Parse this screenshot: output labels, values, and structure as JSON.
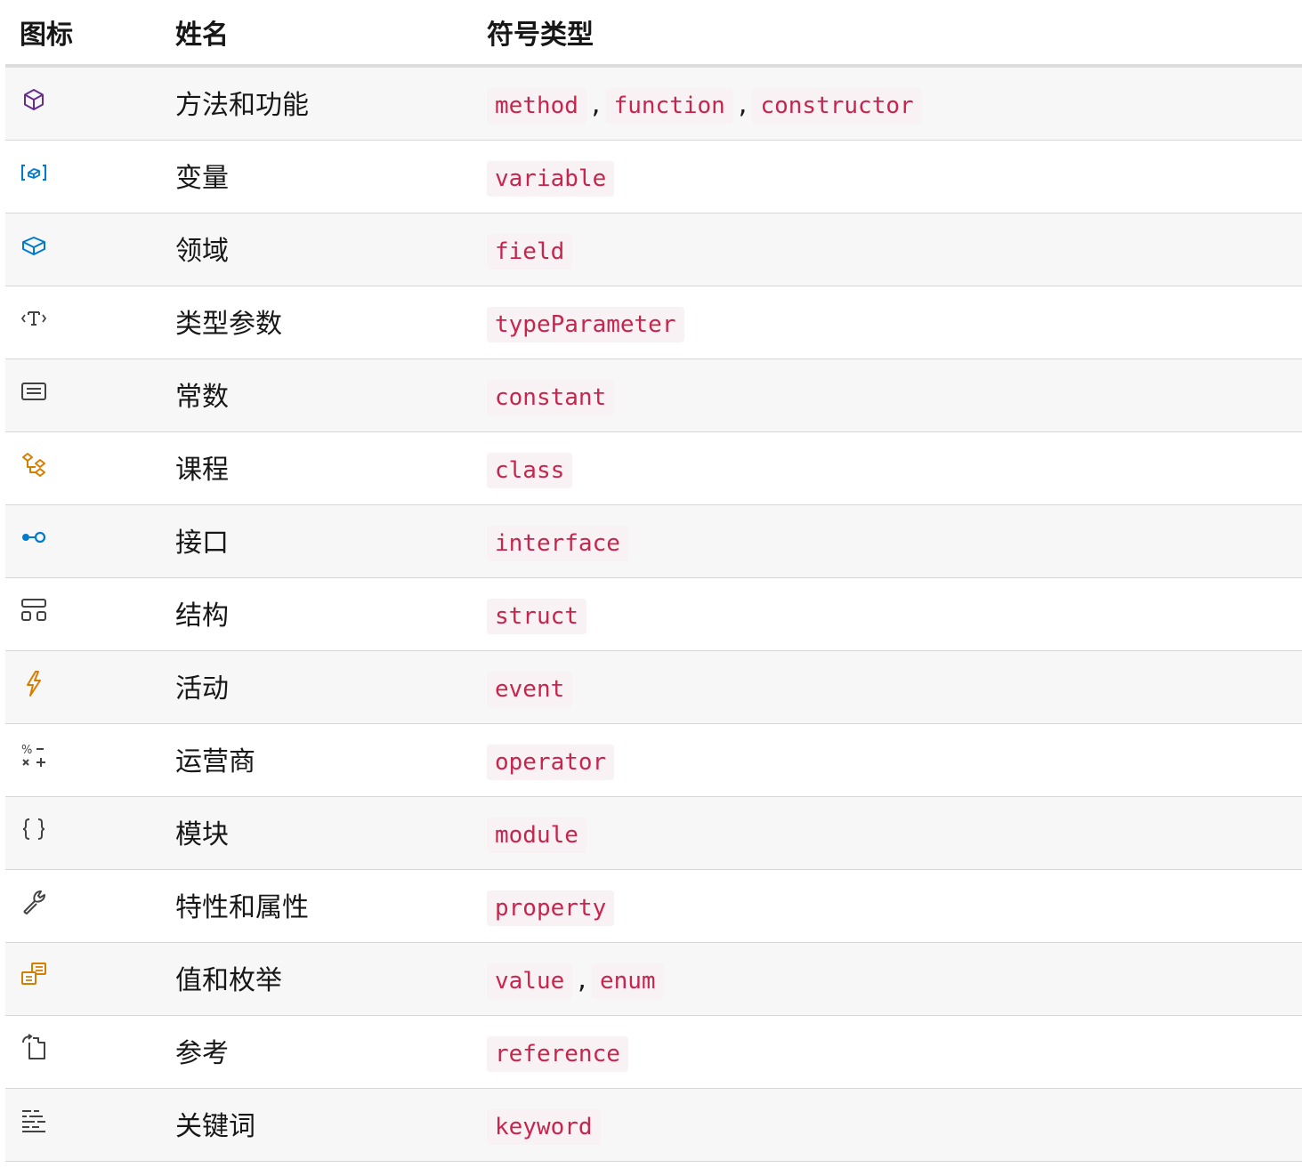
{
  "headers": {
    "icon": "图标",
    "name": "姓名",
    "kind": "符号类型"
  },
  "rows": [
    {
      "icon": "method-cube-icon",
      "color": "#652d90",
      "name": "方法和功能",
      "kinds": [
        "method",
        "function",
        "constructor"
      ]
    },
    {
      "icon": "variable-icon",
      "color": "#007acc",
      "name": "变量",
      "kinds": [
        "variable"
      ]
    },
    {
      "icon": "field-cube-icon",
      "color": "#007acc",
      "name": "领域",
      "kinds": [
        "field"
      ]
    },
    {
      "icon": "type-parameter-icon",
      "color": "#424242",
      "name": "类型参数",
      "kinds": [
        "typeParameter"
      ]
    },
    {
      "icon": "constant-icon",
      "color": "#424242",
      "name": "常数",
      "kinds": [
        "constant"
      ]
    },
    {
      "icon": "class-icon",
      "color": "#d67e00",
      "name": "课程",
      "kinds": [
        "class"
      ]
    },
    {
      "icon": "interface-icon",
      "color": "#007acc",
      "name": "接口",
      "kinds": [
        "interface"
      ]
    },
    {
      "icon": "struct-icon",
      "color": "#424242",
      "name": "结构",
      "kinds": [
        "struct"
      ]
    },
    {
      "icon": "event-lightning-icon",
      "color": "#d67e00",
      "name": "活动",
      "kinds": [
        "event"
      ]
    },
    {
      "icon": "operator-icon",
      "color": "#424242",
      "name": "运营商",
      "kinds": [
        "operator"
      ]
    },
    {
      "icon": "module-braces-icon",
      "color": "#424242",
      "name": "模块",
      "kinds": [
        "module"
      ]
    },
    {
      "icon": "property-wrench-icon",
      "color": "#424242",
      "name": "特性和属性",
      "kinds": [
        "property"
      ]
    },
    {
      "icon": "enum-icon",
      "color": "#d67e00",
      "name": "值和枚举",
      "kinds": [
        "value",
        "enum"
      ]
    },
    {
      "icon": "reference-icon",
      "color": "#424242",
      "name": "参考",
      "kinds": [
        "reference"
      ]
    },
    {
      "icon": "keyword-icon",
      "color": "#424242",
      "name": "关键词",
      "kinds": [
        "keyword"
      ]
    }
  ],
  "separator": ","
}
